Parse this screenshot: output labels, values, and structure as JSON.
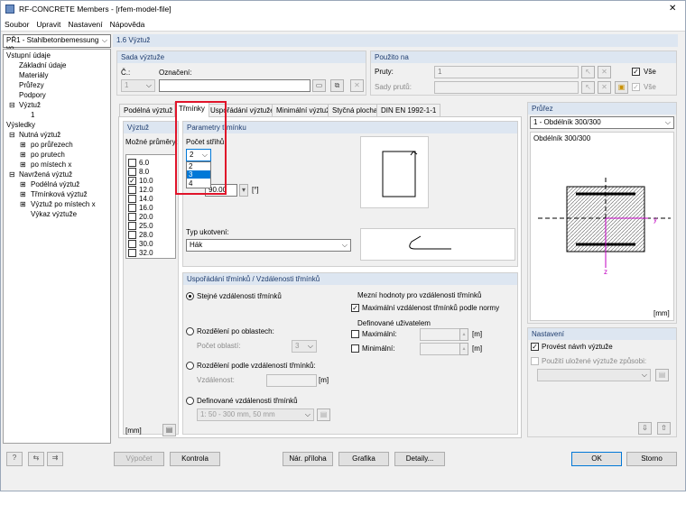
{
  "window": {
    "title": "RF-CONCRETE Members - [rfem-model-file]",
    "close": "✕"
  },
  "menu": [
    "Soubor",
    "Upravit",
    "Nastavení",
    "Nápověda"
  ],
  "case_combo": "PŘ1 - Stahlbetonbemessung vo",
  "tree": {
    "n0": "Vstupní údaje",
    "n1": "Základní údaje",
    "n2": "Materiály",
    "n3": "Průřezy",
    "n4": "Podpory",
    "n5": "Výztuž",
    "n6": "1",
    "n7": "Výsledky",
    "n8": "Nutná výztuž",
    "n9": "po průřezech",
    "n10": "po prutech",
    "n11": "po místech x",
    "n12": "Navržená výztuž",
    "n13": "Podélná výztuž",
    "n14": "Třmínková výztuž",
    "n15": "Výztuž po místech x",
    "n16": "Výkaz výztuže"
  },
  "section_header": "1.6 Výztuž",
  "sada": {
    "header": "Sada výztuže",
    "no_label": "Č.:",
    "no_value": "1",
    "name_label": "Označení:",
    "name_value": ""
  },
  "pouzito": {
    "header": "Použito na",
    "pruty_label": "Pruty:",
    "pruty_value": "1",
    "vse": "Vše",
    "sady_label": "Sady prutů:",
    "vse2": "Vše"
  },
  "tabs": [
    "Podélná výztuž",
    "Třmínky",
    "Uspořádání výztuže",
    "Minimální výztuž",
    "Styčná plocha",
    "DIN EN 1992-1-1"
  ],
  "vyztuz": {
    "header": "Výztuž",
    "label": "Možné průměry:",
    "diameters": [
      "6.0",
      "8.0",
      "10.0",
      "12.0",
      "14.0",
      "16.0",
      "20.0",
      "25.0",
      "28.0",
      "30.0",
      "32.0"
    ],
    "checked": [
      false,
      false,
      true,
      false,
      false,
      false,
      false,
      false,
      false,
      false,
      false
    ],
    "unit": "[mm]"
  },
  "parametry": {
    "header": "Parametry třmínku",
    "strih_label": "Počet střihů:",
    "strih_value": "2",
    "options": [
      "2",
      "3",
      "4"
    ],
    "selected_option": "3",
    "angle_value": "90.00",
    "angle_unit": "[°]",
    "kotveni_label": "Typ ukotvení:",
    "kotveni_value": "Hák"
  },
  "usporadani": {
    "header": "Uspořádání třmínků / Vzdálenosti třmínků",
    "r1": "Stejné vzdálenosti třmínků",
    "r2": "Rozdělení po oblastech:",
    "r2_sub": "Počet oblastí:",
    "r2_val": "3",
    "r3": "Rozdělení podle vzdáleností třmínků:",
    "r3_sub": "Vzdálenost:",
    "r3_unit": "[m]",
    "r4": "Definované vzdálenosti třmínků",
    "r4_val": "1: 50 - 300 mm, 50 mm",
    "mez": "Mezní hodnoty pro vzdálenosti třmínků",
    "max_norm": "Maximální vzdálenost třmínků podle normy",
    "def_user": "Definované uživatelem",
    "max": "Maximální:",
    "min": "Minimální:",
    "unit": "[m]"
  },
  "prurez": {
    "header": "Průřez",
    "combo": "1 - Obdélník 300/300",
    "name": "Obdélník 300/300",
    "y": "y",
    "z": "z",
    "unit": "[mm]"
  },
  "nastaveni": {
    "header": "Nastavení",
    "c1": "Provést návrh výztuže",
    "c2": "Použití uložené výztuže způsobi:"
  },
  "buttons": {
    "vypocet": "Výpočet",
    "kontrola": "Kontrola",
    "priloha": "Nár. příloha",
    "grafika": "Grafika",
    "detaily": "Detaily...",
    "ok": "OK",
    "storno": "Storno"
  },
  "colors": {
    "header_bg": "#dde6f1",
    "header_text": "#1e3c6e",
    "highlight": "#e0142a",
    "select": "#0078d7",
    "axis_y": "#c000c0"
  }
}
